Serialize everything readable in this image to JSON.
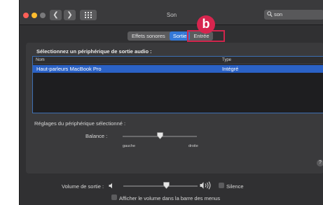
{
  "window": {
    "title": "Son"
  },
  "toolbar": {
    "back_icon": "chevron-left-icon",
    "forward_icon": "chevron-right-icon",
    "grid_icon": "grid-icon",
    "search_value": "son",
    "search_icon": "magnifier-icon"
  },
  "tabs": [
    {
      "label": "Effets sonores",
      "active": false
    },
    {
      "label": "Sortie",
      "active": true
    },
    {
      "label": "Entrée",
      "active": false
    }
  ],
  "annotation": {
    "badge": "b",
    "color": "#d7254e"
  },
  "output": {
    "section_title": "Sélectionnez un périphérique de sortie audio :",
    "columns": [
      "Nom",
      "Type"
    ],
    "rows": [
      {
        "name": "Haut-parleurs MacBook Pro",
        "type": "Intégré",
        "selected": true
      }
    ]
  },
  "device_settings": {
    "label": "Réglages du périphérique sélectionné :",
    "balance_label": "Balance :",
    "balance_left": "gauche",
    "balance_right": "droite",
    "balance_value": 0.5
  },
  "help_label": "?",
  "volume": {
    "label": "Volume de sortie :",
    "level": 0.58,
    "mute_label": "Silence",
    "mute_checked": false,
    "show_in_menubar_label": "Afficher le volume dans la barre des menus",
    "show_in_menubar_checked": false
  },
  "colors": {
    "accent": "#2b62c6",
    "window_bg": "#303032"
  }
}
